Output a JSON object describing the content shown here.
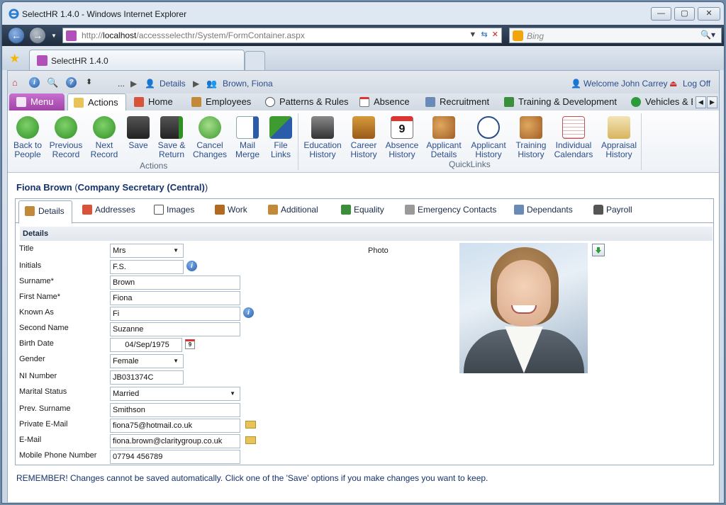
{
  "window": {
    "title": "SelectHR 1.4.0 - Windows Internet Explorer"
  },
  "browser": {
    "address_gray": "http://",
    "address_host": "localhost",
    "address_rest": "/accessselecthr/System/FormContainer.aspx",
    "search_placeholder": "Bing",
    "tab_title": "SelectHR 1.4.0"
  },
  "topbar": {
    "ellipsis": "...",
    "crumb_details": "Details",
    "crumb_person": "Brown, Fiona",
    "welcome": "Welcome John Carrey",
    "logoff": "Log Off"
  },
  "ribbon_tabs": {
    "menu": "Menu",
    "items": [
      "Actions",
      "Home",
      "Employees",
      "Patterns & Rules",
      "Absence",
      "Recruitment",
      "Training & Development",
      "Vehicles & Be"
    ]
  },
  "ribbon": {
    "actions": [
      {
        "l1": "Back to",
        "l2": "People"
      },
      {
        "l1": "Previous",
        "l2": "Record"
      },
      {
        "l1": "Next",
        "l2": "Record"
      },
      {
        "l1": "Save",
        "l2": ""
      },
      {
        "l1": "Save &",
        "l2": "Return"
      },
      {
        "l1": "Cancel",
        "l2": "Changes"
      },
      {
        "l1": "Mail",
        "l2": "Merge"
      },
      {
        "l1": "File",
        "l2": "Links"
      }
    ],
    "actions_group": "Actions",
    "quicklinks": [
      {
        "l1": "Education",
        "l2": "History"
      },
      {
        "l1": "Career",
        "l2": "History"
      },
      {
        "l1": "Absence",
        "l2": "History"
      },
      {
        "l1": "Applicant",
        "l2": "Details"
      },
      {
        "l1": "Applicant",
        "l2": "History"
      },
      {
        "l1": "Training",
        "l2": "History"
      },
      {
        "l1": "Individual",
        "l2": "Calendars"
      },
      {
        "l1": "Appraisal",
        "l2": "History"
      }
    ],
    "quicklinks_group": "QuickLinks"
  },
  "record": {
    "name": "Fiona Brown",
    "paren_open": " (",
    "role": "Company Secretary (Central)",
    "paren_close": ")"
  },
  "form_tabs": [
    "Details",
    "Addresses",
    "Images",
    "Work",
    "Additional",
    "Equality",
    "Emergency Contacts",
    "Dependants",
    "Payroll"
  ],
  "section": "Details",
  "fields": [
    {
      "label": "Title",
      "value": "Mrs"
    },
    {
      "label": "Initials",
      "value": "F.S."
    },
    {
      "label": "Surname*",
      "value": "Brown"
    },
    {
      "label": "First Name*",
      "value": "Fiona"
    },
    {
      "label": "Known As",
      "value": "Fi"
    },
    {
      "label": "Second Name",
      "value": "Suzanne"
    },
    {
      "label": "Birth Date",
      "value": "04/Sep/1975"
    },
    {
      "label": "Gender",
      "value": "Female"
    },
    {
      "label": "NI Number",
      "value": "JB031374C"
    },
    {
      "label": "Marital Status",
      "value": "Married"
    },
    {
      "label": "Prev. Surname",
      "value": "Smithson"
    },
    {
      "label": "Private E-Mail",
      "value": "fiona75@hotmail.co.uk"
    },
    {
      "label": "E-Mail",
      "value": "fiona.brown@claritygroup.co.uk"
    },
    {
      "label": "Mobile Phone Number",
      "value": "07794 456789"
    }
  ],
  "photo_label": "Photo",
  "calendar_day": "9",
  "info_glyph": "i",
  "footer_note": "REMEMBER! Changes cannot be saved automatically. Click one of the 'Save' options if you make changes you want to keep."
}
